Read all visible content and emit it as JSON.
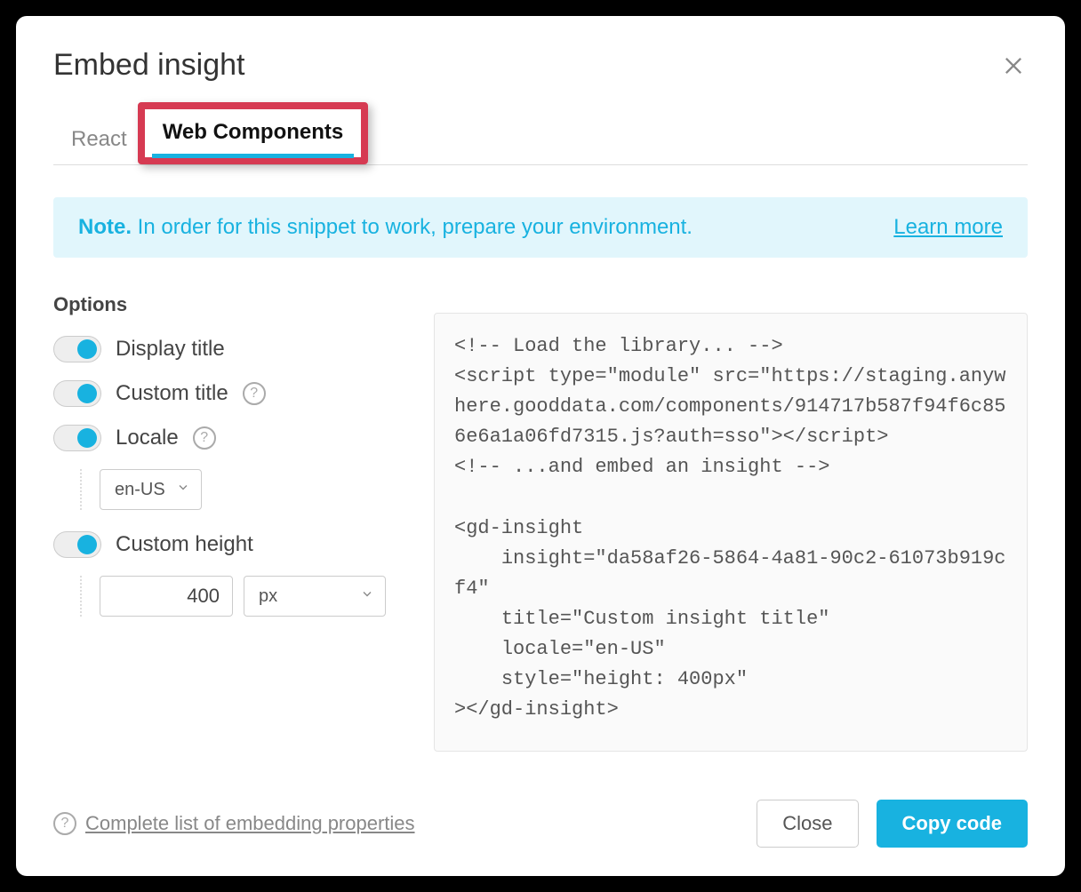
{
  "dialog": {
    "title": "Embed insight"
  },
  "tabs": {
    "react": "React",
    "webcomponents": "Web Components"
  },
  "note": {
    "bold": "Note.",
    "text": " In order for this snippet to work, prepare your environment.",
    "learn_more": "Learn more"
  },
  "options": {
    "heading": "Options",
    "display_title": "Display title",
    "custom_title": "Custom title",
    "locale": "Locale",
    "locale_value": "en-US",
    "custom_height": "Custom height",
    "height_value": "400",
    "height_unit": "px"
  },
  "code": "<!-- Load the library... -->\n<script type=\"module\" src=\"https://staging.anywhere.gooddata.com/components/914717b587f94f6c856e6a1a06fd7315.js?auth=sso\"></script>\n<!-- ...and embed an insight -->\n\n<gd-insight\n    insight=\"da58af26-5864-4a81-90c2-61073b919cf4\"\n    title=\"Custom insight title\"\n    locale=\"en-US\"\n    style=\"height: 400px\"\n></gd-insight>",
  "footer": {
    "complete_list": "Complete list of embedding properties",
    "close": "Close",
    "copy": "Copy code"
  }
}
